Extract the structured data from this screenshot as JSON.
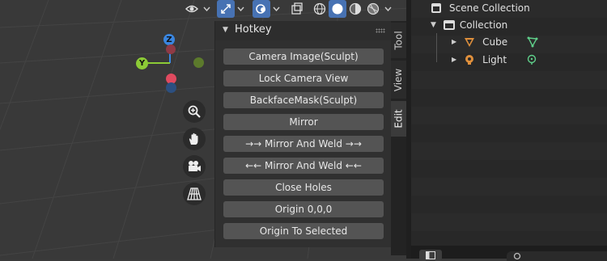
{
  "panel": {
    "title": "Hotkey",
    "buttons": [
      "Camera Image(Sculpt)",
      "Lock Camera View",
      "BackfaceMask(Sculpt)",
      "Mirror",
      "→→ Mirror And Weld →→",
      "←← Mirror And Weld ←←",
      "Close Holes",
      "Origin 0,0,0",
      "Origin To Selected"
    ]
  },
  "tabs": [
    "Tool",
    "View",
    "Edit"
  ],
  "gizmo": {
    "z": "Z",
    "y": "Y"
  },
  "outliner": {
    "scene": "Scene Collection",
    "collection": "Collection",
    "cube": "Cube",
    "light": "Light"
  },
  "colors": {
    "x_axis": "#e04a5f",
    "y_axis": "#8ccb36",
    "z_axis": "#3a86e0",
    "mesh_icon": "#e0903c",
    "data_icon": "#5fcf8a"
  }
}
